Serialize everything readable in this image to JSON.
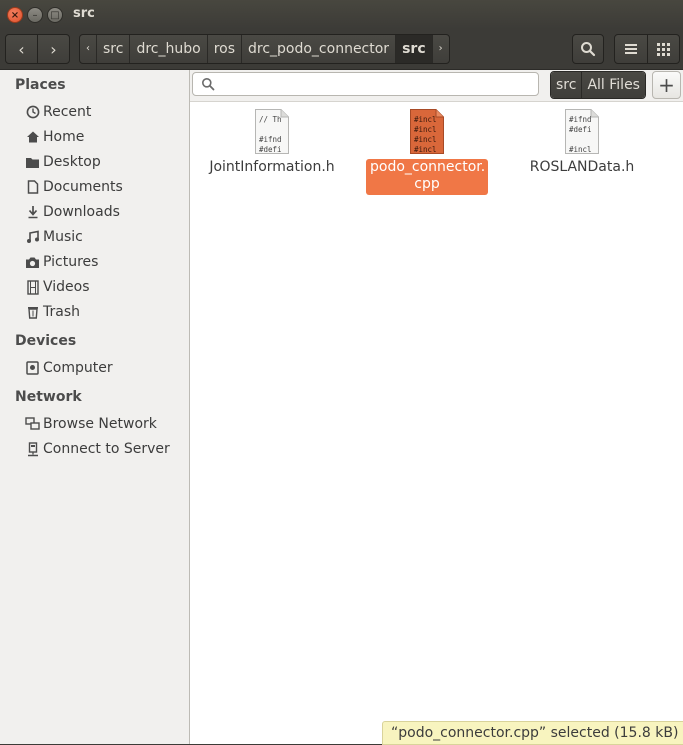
{
  "window": {
    "title": "src"
  },
  "titlebar": {
    "close_glyph": "×",
    "min_glyph": "–",
    "max_glyph": "□"
  },
  "toolbar": {
    "back_glyph": "‹",
    "forward_glyph": "›",
    "breadcrumb_left_arrow": "‹",
    "breadcrumb_right_arrow": "›",
    "breadcrumbs": [
      "src",
      "drc_hubo",
      "ros",
      "drc_podo_connector",
      "src"
    ],
    "search_icon": "search-icon",
    "list_view_icon": "list-view-icon",
    "grid_view_icon": "grid-view-icon"
  },
  "sidebar": {
    "sections": [
      {
        "title": "Places",
        "items": [
          {
            "label": "Recent",
            "icon": "clock-icon"
          },
          {
            "label": "Home",
            "icon": "home-icon"
          },
          {
            "label": "Desktop",
            "icon": "folder-icon"
          },
          {
            "label": "Documents",
            "icon": "document-icon"
          },
          {
            "label": "Downloads",
            "icon": "download-icon"
          },
          {
            "label": "Music",
            "icon": "music-icon"
          },
          {
            "label": "Pictures",
            "icon": "camera-icon"
          },
          {
            "label": "Videos",
            "icon": "film-icon"
          },
          {
            "label": "Trash",
            "icon": "trash-icon"
          }
        ]
      },
      {
        "title": "Devices",
        "items": [
          {
            "label": "Computer",
            "icon": "drive-icon"
          }
        ]
      },
      {
        "title": "Network",
        "items": [
          {
            "label": "Browse Network",
            "icon": "network-icon"
          },
          {
            "label": "Connect to Server",
            "icon": "server-icon"
          }
        ]
      }
    ]
  },
  "searchbar": {
    "value": "",
    "scope_options": [
      "src",
      "All Files"
    ],
    "add_label": "+"
  },
  "files": [
    {
      "name": "JointInformation.h",
      "preview": "// Th\n\n#ifnd\n#defi",
      "selected": false
    },
    {
      "name": "podo_connector.cpp",
      "name_line1": "podo_connector.",
      "name_line2": "cpp",
      "preview": "#incl\n#incl\n#incl\n#incl",
      "selected": true
    },
    {
      "name": "ROSLANData.h",
      "preview": "#ifnd\n#defi\n\n#incl",
      "selected": false
    }
  ],
  "status": {
    "text": "“podo_connector.cpp” selected  (15.8 kB)"
  },
  "colors": {
    "accent": "#f07746",
    "toolbar": "#3c3b37",
    "sidebar": "#f1f0ee",
    "status_bg": "#f8f4bf"
  }
}
